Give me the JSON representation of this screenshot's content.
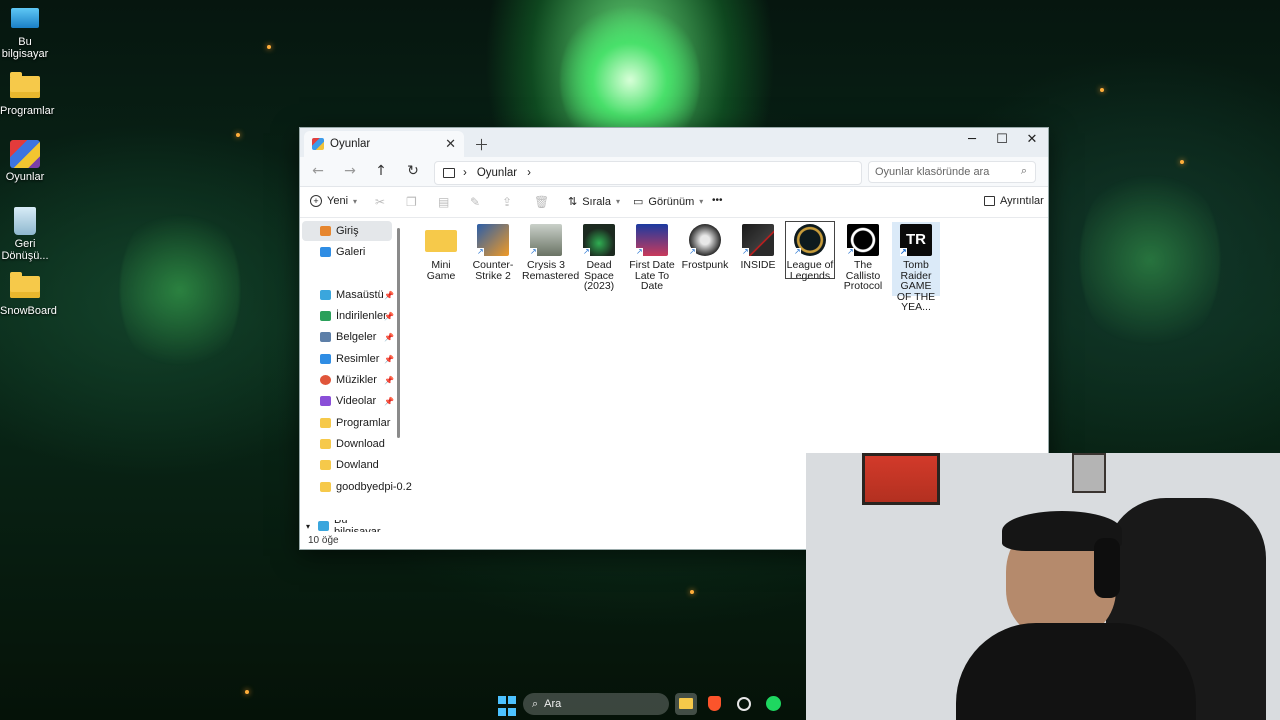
{
  "desktop": {
    "icons": [
      {
        "label": "Bu bilgisayar",
        "icon": "computer-icon"
      },
      {
        "label": "Programlar",
        "icon": "folder-icon"
      },
      {
        "label": "Oyunlar",
        "icon": "winrar-icon"
      },
      {
        "label": "Geri Dönüşü...",
        "icon": "recycle-bin-icon"
      },
      {
        "label": "SnowBoard",
        "icon": "folder-icon"
      }
    ]
  },
  "window": {
    "tab_title": "Oyunlar",
    "controls": {
      "minimize": "─",
      "maximize": "☐",
      "close": "✕"
    },
    "address": {
      "path_segment": "Oyunlar",
      "search_placeholder": "Oyunlar klasöründe ara"
    },
    "toolbar": {
      "new": "Yeni",
      "sort": "Sırala",
      "view": "Görünüm",
      "more": "•••",
      "details": "Ayrıntılar"
    },
    "sidebar": {
      "items": [
        {
          "label": "Giriş",
          "color": "#e6862f",
          "pinned": false
        },
        {
          "label": "Galeri",
          "color": "#2f8de4",
          "pinned": false
        },
        {
          "label": "Masaüstü",
          "color": "#3aa6dd",
          "pinned": true
        },
        {
          "label": "İndirilenler",
          "color": "#2aa05a",
          "pinned": true
        },
        {
          "label": "Belgeler",
          "color": "#5d7fa8",
          "pinned": true
        },
        {
          "label": "Resimler",
          "color": "#2f8de4",
          "pinned": true
        },
        {
          "label": "Müzikler",
          "color": "#e0553a",
          "pinned": true
        },
        {
          "label": "Videolar",
          "color": "#8a4fd8",
          "pinned": true
        },
        {
          "label": "Programlar",
          "color": "#f6c94a",
          "pinned": false
        },
        {
          "label": "Download",
          "color": "#f6c94a",
          "pinned": false
        },
        {
          "label": "Dowland",
          "color": "#f6c94a",
          "pinned": false
        },
        {
          "label": "goodbyedpi-0.2",
          "color": "#f6c94a",
          "pinned": false
        },
        {
          "label": "Bu bilgisayar",
          "color": "#3aa6dd",
          "pinned": false
        }
      ]
    },
    "files": [
      {
        "label": "Mini Game",
        "kind": "folder"
      },
      {
        "label": "Counter-Strike 2",
        "kind": "shortcut"
      },
      {
        "label": "Crysis 3 Remastered",
        "kind": "shortcut"
      },
      {
        "label": "Dead Space (2023)",
        "kind": "shortcut"
      },
      {
        "label": "First Date Late To Date",
        "kind": "shortcut"
      },
      {
        "label": "Frostpunk",
        "kind": "shortcut"
      },
      {
        "label": "INSIDE",
        "kind": "shortcut"
      },
      {
        "label": "League of Legends",
        "kind": "shortcut"
      },
      {
        "label": "The Callisto Protocol",
        "kind": "shortcut"
      },
      {
        "label": "Tomb Raider GAME OF THE YEA...",
        "kind": "shortcut"
      }
    ],
    "status": "10 öğe"
  },
  "taskbar": {
    "search_placeholder": "Ara"
  }
}
